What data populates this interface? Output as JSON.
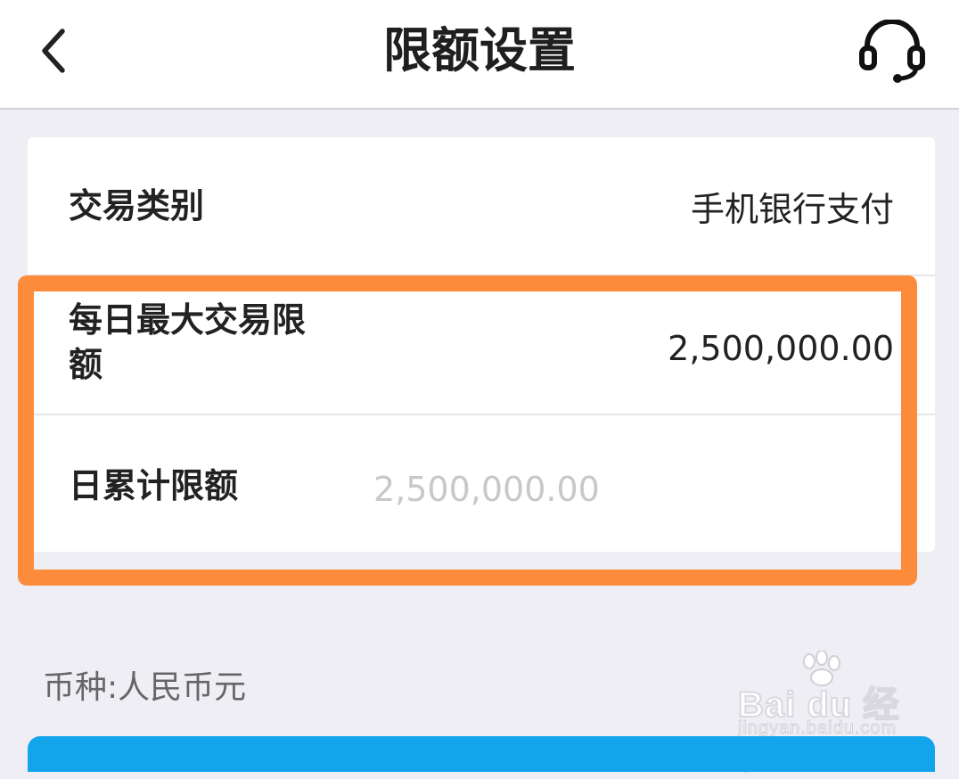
{
  "header": {
    "title": "限额设置",
    "back_icon": "chevron-left-icon",
    "service_icon": "headset-icon"
  },
  "card": {
    "transaction_type": {
      "label": "交易类别",
      "value": "手机银行支付"
    },
    "daily_max_limit": {
      "label": "每日最大交易限额",
      "value": "2,500,000.00"
    },
    "cumulative_limit": {
      "label": "日累计限额",
      "placeholder": "2,500,000.00",
      "value": ""
    }
  },
  "currency_note": "币种:人民币元",
  "watermark": {
    "brand": "Bai du 经验",
    "url": "jingyan.baidu.com"
  },
  "colors": {
    "highlight": "#fc8b3c",
    "primary_button": "#13a5ec",
    "background": "#eeeef4"
  }
}
